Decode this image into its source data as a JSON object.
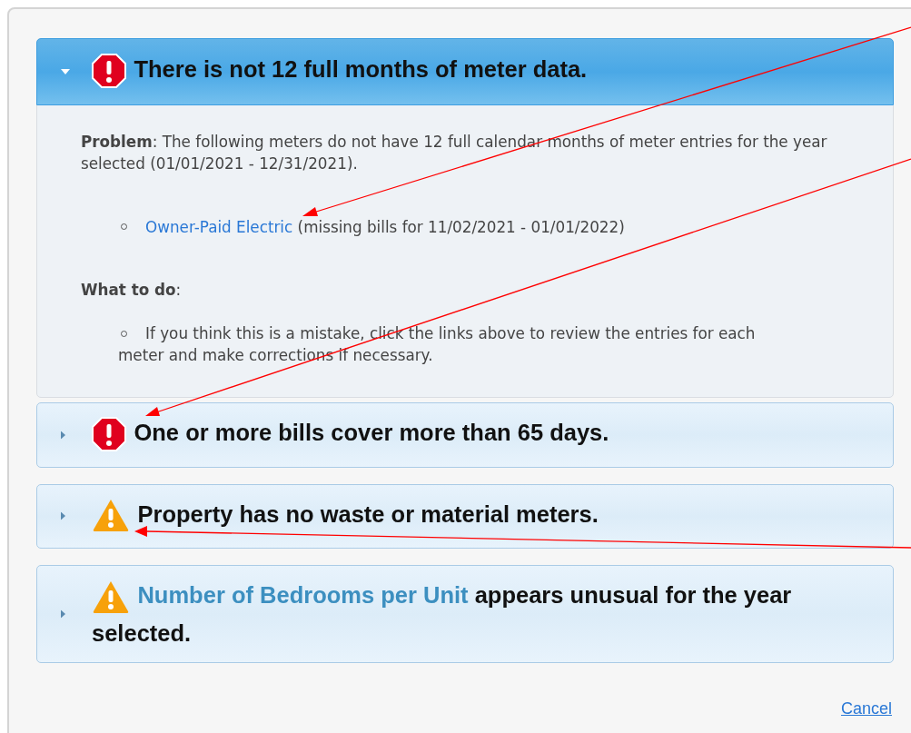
{
  "issues": [
    {
      "kind": "error",
      "expanded": true,
      "title": "There is not 12 full months of meter data.",
      "body": {
        "problem": "**Problem**: The following meters do not have 12 full calendar months of meter entries for the year selected (01/01/2021 - 12/31/2021).",
        "meters": [
          {
            "link": "Owner-Paid Electric",
            "note": "(missing bills for 11/02/2021 - 01/01/2022)"
          }
        ],
        "what_to_do": "**What to do**:",
        "steps": [
          "If you think this is a mistake, click the links above to review the entries for each meter and make corrections if necessary."
        ]
      }
    },
    {
      "kind": "error",
      "expanded": false,
      "title": "One or more bills cover more than 65 days."
    },
    {
      "kind": "warning",
      "expanded": false,
      "title": "Property has no waste or material meters."
    },
    {
      "kind": "warning",
      "expanded": false,
      "title_link": "Number of Bedrooms per Unit",
      "title": "appears unusual for the year selected."
    }
  ],
  "cancel": "Cancel"
}
